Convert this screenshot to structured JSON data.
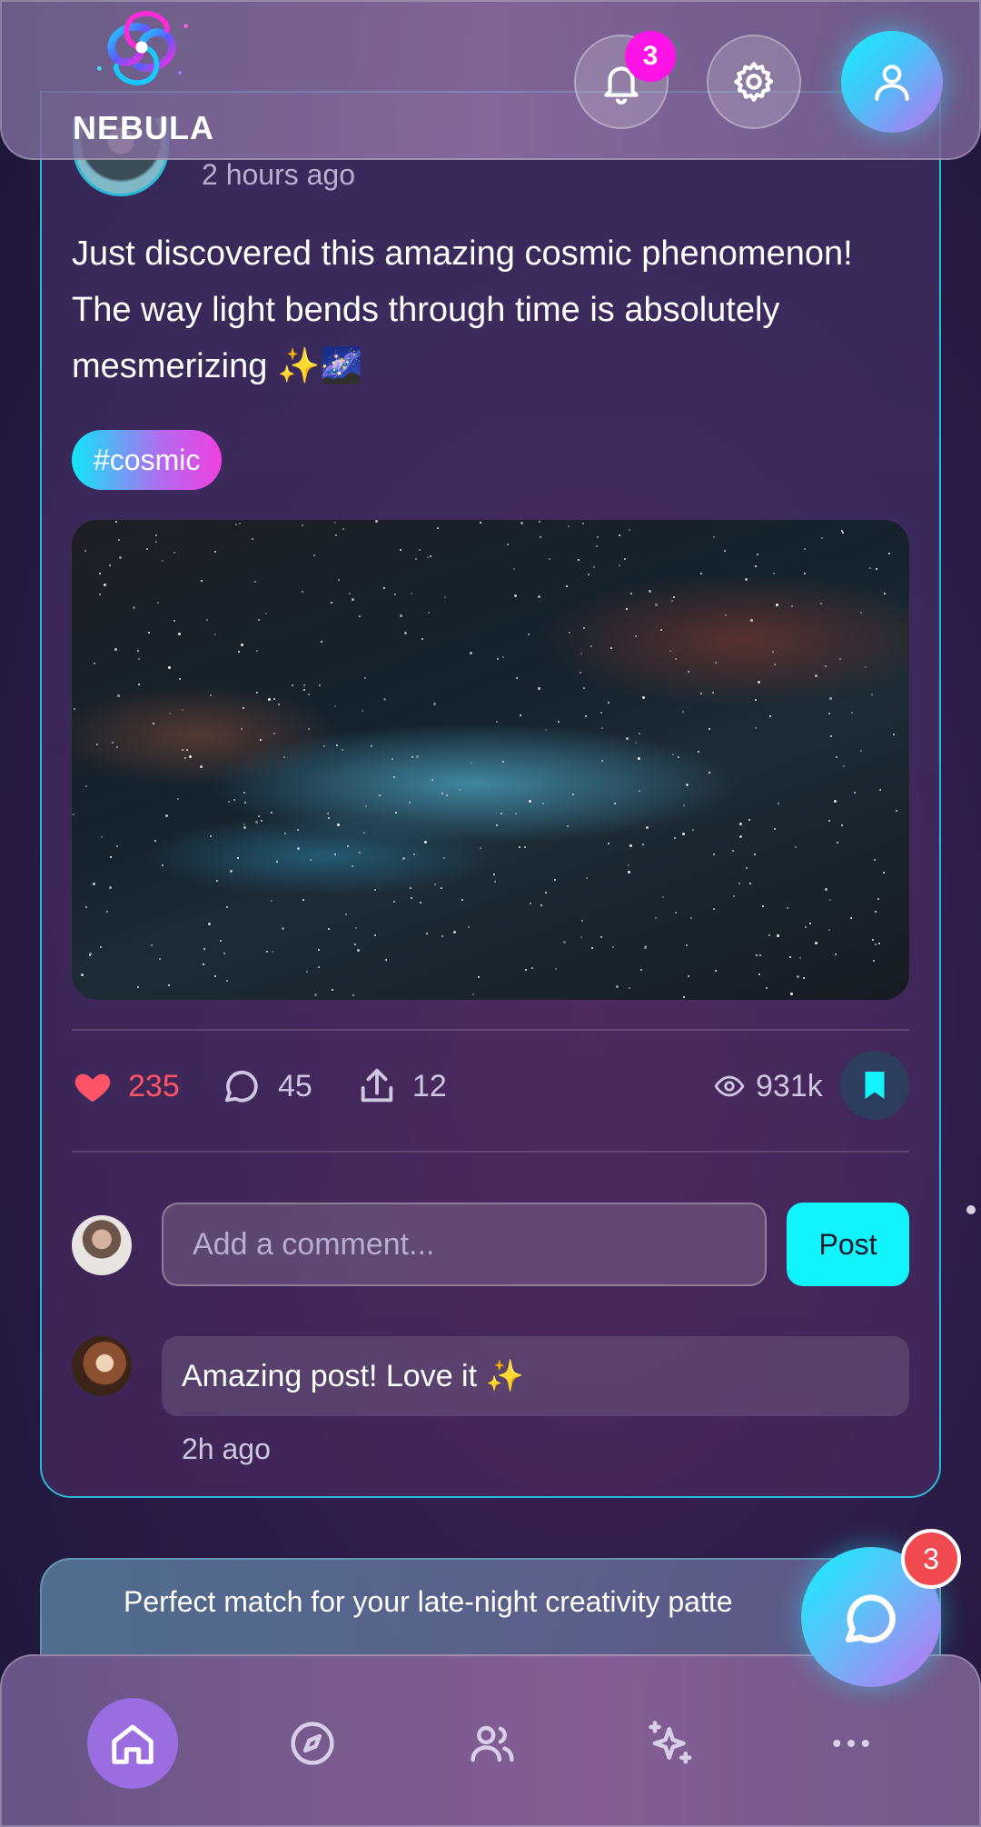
{
  "header": {
    "logo_text": "NEBULA",
    "notification_count": "3"
  },
  "post": {
    "time": "2 hours ago",
    "text": "Just discovered this amazing cosmic phenomenon! The way light bends through time is absolutely mesmerizing ✨🌌",
    "tag": "#cosmic",
    "likes": "235",
    "comments": "45",
    "shares": "12",
    "views": "931k",
    "liked": true,
    "bookmarked": true
  },
  "comment_box": {
    "placeholder": "Add a comment...",
    "post_label": "Post"
  },
  "comments": [
    {
      "text": "Amazing post! Love it ✨",
      "time": "2h ago"
    }
  ],
  "next_card": {
    "text": "Perfect match for your late-night creativity patte"
  },
  "chat": {
    "unread_count": "3"
  },
  "nav": {
    "active": "home",
    "items": [
      "home",
      "explore",
      "people",
      "sparkle",
      "more"
    ]
  },
  "colors": {
    "accent_cyan": "#12f4fb",
    "accent_pink": "#ff13e6",
    "like_red": "#ff5468",
    "nav_active": "#9a6de0"
  }
}
